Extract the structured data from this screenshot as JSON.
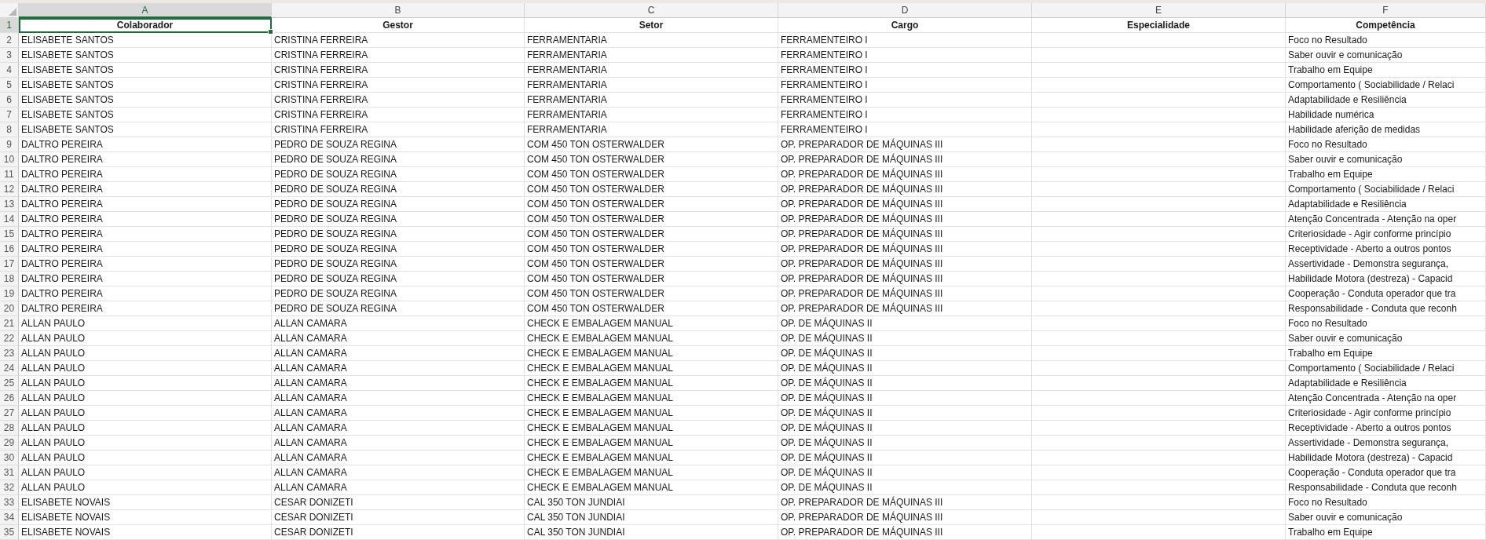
{
  "columns": [
    {
      "letter": "A",
      "title": "Colaborador",
      "selected": true
    },
    {
      "letter": "B",
      "title": "Gestor",
      "selected": false
    },
    {
      "letter": "C",
      "title": "Setor",
      "selected": false
    },
    {
      "letter": "D",
      "title": "Cargo",
      "selected": false
    },
    {
      "letter": "E",
      "title": "Especialidade",
      "selected": false
    },
    {
      "letter": "F",
      "title": "Competência",
      "selected": false
    }
  ],
  "header_row": {
    "number": "1",
    "selected": true
  },
  "rows": [
    {
      "number": "2",
      "colaborador": "ELISABETE SANTOS",
      "gestor": "CRISTINA FERREIRA",
      "setor": "FERRAMENTARIA",
      "cargo": "FERRAMENTEIRO I",
      "competencia": "Foco no Resultado",
      "selected": false
    },
    {
      "number": "3",
      "colaborador": "ELISABETE SANTOS",
      "gestor": "CRISTINA FERREIRA",
      "setor": "FERRAMENTARIA",
      "cargo": "FERRAMENTEIRO I",
      "competencia": "Saber ouvir e comunicação",
      "selected": false
    },
    {
      "number": "4",
      "colaborador": "ELISABETE SANTOS",
      "gestor": "CRISTINA FERREIRA",
      "setor": "FERRAMENTARIA",
      "cargo": "FERRAMENTEIRO I",
      "competencia": "Trabalho em Equipe",
      "selected": false
    },
    {
      "number": "5",
      "colaborador": "ELISABETE SANTOS",
      "gestor": "CRISTINA FERREIRA",
      "setor": "FERRAMENTARIA",
      "cargo": "FERRAMENTEIRO I",
      "competencia": "Comportamento ( Sociabilidade / Relaci",
      "selected": false
    },
    {
      "number": "6",
      "colaborador": "ELISABETE SANTOS",
      "gestor": "CRISTINA FERREIRA",
      "setor": "FERRAMENTARIA",
      "cargo": "FERRAMENTEIRO I",
      "competencia": "Adaptabilidade e Resiliência",
      "selected": false
    },
    {
      "number": "7",
      "colaborador": "ELISABETE SANTOS",
      "gestor": "CRISTINA FERREIRA",
      "setor": "FERRAMENTARIA",
      "cargo": "FERRAMENTEIRO I",
      "competencia": "Habilidade numérica",
      "selected": false
    },
    {
      "number": "8",
      "colaborador": "ELISABETE SANTOS",
      "gestor": "CRISTINA FERREIRA",
      "setor": "FERRAMENTARIA",
      "cargo": "FERRAMENTEIRO I",
      "competencia": "Habilidade aferição de medidas",
      "selected": false
    },
    {
      "number": "9",
      "colaborador": "DALTRO PEREIRA",
      "gestor": "PEDRO DE SOUZA REGINA",
      "setor": "COM 450 TON OSTERWALDER",
      "cargo": "OP. PREPARADOR DE MÁQUINAS III",
      "competencia": "Foco no Resultado",
      "selected": false
    },
    {
      "number": "10",
      "colaborador": "DALTRO PEREIRA",
      "gestor": "PEDRO DE SOUZA REGINA",
      "setor": "COM 450 TON OSTERWALDER",
      "cargo": "OP. PREPARADOR DE MÁQUINAS III",
      "competencia": "Saber ouvir e comunicação",
      "selected": false
    },
    {
      "number": "11",
      "colaborador": "DALTRO PEREIRA",
      "gestor": "PEDRO DE SOUZA REGINA",
      "setor": "COM 450 TON OSTERWALDER",
      "cargo": "OP. PREPARADOR DE MÁQUINAS III",
      "competencia": "Trabalho em Equipe",
      "selected": false
    },
    {
      "number": "12",
      "colaborador": "DALTRO PEREIRA",
      "gestor": "PEDRO DE SOUZA REGINA",
      "setor": "COM 450 TON OSTERWALDER",
      "cargo": "OP. PREPARADOR DE MÁQUINAS III",
      "competencia": "Comportamento ( Sociabilidade / Relaci",
      "selected": false
    },
    {
      "number": "13",
      "colaborador": "DALTRO PEREIRA",
      "gestor": "PEDRO DE SOUZA REGINA",
      "setor": "COM 450 TON OSTERWALDER",
      "cargo": "OP. PREPARADOR DE MÁQUINAS III",
      "competencia": "Adaptabilidade e Resiliência",
      "selected": false
    },
    {
      "number": "14",
      "colaborador": "DALTRO PEREIRA",
      "gestor": "PEDRO DE SOUZA REGINA",
      "setor": "COM 450 TON OSTERWALDER",
      "cargo": "OP. PREPARADOR DE MÁQUINAS III",
      "competencia": "Atenção Concentrada - Atenção na oper",
      "selected": false
    },
    {
      "number": "15",
      "colaborador": "DALTRO PEREIRA",
      "gestor": "PEDRO DE SOUZA REGINA",
      "setor": "COM 450 TON OSTERWALDER",
      "cargo": "OP. PREPARADOR DE MÁQUINAS III",
      "competencia": "Criteriosidade - Agir conforme princípio",
      "selected": false
    },
    {
      "number": "16",
      "colaborador": "DALTRO PEREIRA",
      "gestor": "PEDRO DE SOUZA REGINA",
      "setor": "COM 450 TON OSTERWALDER",
      "cargo": "OP. PREPARADOR DE MÁQUINAS III",
      "competencia": "Receptividade - Aberto a outros pontos",
      "selected": false
    },
    {
      "number": "17",
      "colaborador": "DALTRO PEREIRA",
      "gestor": "PEDRO DE SOUZA REGINA",
      "setor": "COM 450 TON OSTERWALDER",
      "cargo": "OP. PREPARADOR DE MÁQUINAS III",
      "competencia": "Assertividade - Demonstra segurança,",
      "selected": false
    },
    {
      "number": "18",
      "colaborador": "DALTRO PEREIRA",
      "gestor": "PEDRO DE SOUZA REGINA",
      "setor": "COM 450 TON OSTERWALDER",
      "cargo": "OP. PREPARADOR DE MÁQUINAS III",
      "competencia": "Habilidade Motora (destreza) - Capacid",
      "selected": false
    },
    {
      "number": "19",
      "colaborador": "DALTRO PEREIRA",
      "gestor": "PEDRO DE SOUZA REGINA",
      "setor": "COM 450 TON OSTERWALDER",
      "cargo": "OP. PREPARADOR DE MÁQUINAS III",
      "competencia": "Cooperação - Conduta operador que tra",
      "selected": false
    },
    {
      "number": "20",
      "colaborador": "DALTRO PEREIRA",
      "gestor": "PEDRO DE SOUZA REGINA",
      "setor": "COM 450 TON OSTERWALDER",
      "cargo": "OP. PREPARADOR DE MÁQUINAS III",
      "competencia": "Responsabilidade - Conduta que reconh",
      "selected": false
    },
    {
      "number": "21",
      "colaborador": "ALLAN PAULO",
      "gestor": "ALLAN CAMARA",
      "setor": "CHECK E EMBALAGEM MANUAL",
      "cargo": "OP. DE MÁQUINAS II",
      "competencia": "Foco no Resultado",
      "selected": false
    },
    {
      "number": "22",
      "colaborador": "ALLAN PAULO",
      "gestor": "ALLAN CAMARA",
      "setor": "CHECK E EMBALAGEM MANUAL",
      "cargo": "OP. DE MÁQUINAS II",
      "competencia": "Saber ouvir e comunicação",
      "selected": false
    },
    {
      "number": "23",
      "colaborador": "ALLAN PAULO",
      "gestor": "ALLAN CAMARA",
      "setor": "CHECK E EMBALAGEM MANUAL",
      "cargo": "OP. DE MÁQUINAS II",
      "competencia": "Trabalho em Equipe",
      "selected": false
    },
    {
      "number": "24",
      "colaborador": "ALLAN PAULO",
      "gestor": "ALLAN CAMARA",
      "setor": "CHECK E EMBALAGEM MANUAL",
      "cargo": "OP. DE MÁQUINAS II",
      "competencia": "Comportamento ( Sociabilidade / Relaci",
      "selected": false
    },
    {
      "number": "25",
      "colaborador": "ALLAN PAULO",
      "gestor": "ALLAN CAMARA",
      "setor": "CHECK E EMBALAGEM MANUAL",
      "cargo": "OP. DE MÁQUINAS II",
      "competencia": "Adaptabilidade e Resiliência",
      "selected": false
    },
    {
      "number": "26",
      "colaborador": "ALLAN PAULO",
      "gestor": "ALLAN CAMARA",
      "setor": "CHECK E EMBALAGEM MANUAL",
      "cargo": "OP. DE MÁQUINAS II",
      "competencia": "Atenção Concentrada - Atenção na oper",
      "selected": false
    },
    {
      "number": "27",
      "colaborador": "ALLAN PAULO",
      "gestor": "ALLAN CAMARA",
      "setor": "CHECK E EMBALAGEM MANUAL",
      "cargo": "OP. DE MÁQUINAS II",
      "competencia": "Criteriosidade - Agir conforme princípio",
      "selected": false
    },
    {
      "number": "28",
      "colaborador": "ALLAN PAULO",
      "gestor": "ALLAN CAMARA",
      "setor": "CHECK E EMBALAGEM MANUAL",
      "cargo": "OP. DE MÁQUINAS II",
      "competencia": "Receptividade - Aberto a outros pontos",
      "selected": false
    },
    {
      "number": "29",
      "colaborador": "ALLAN PAULO",
      "gestor": "ALLAN CAMARA",
      "setor": "CHECK E EMBALAGEM MANUAL",
      "cargo": "OP. DE MÁQUINAS II",
      "competencia": "Assertividade - Demonstra segurança,",
      "selected": false
    },
    {
      "number": "30",
      "colaborador": "ALLAN PAULO",
      "gestor": "ALLAN CAMARA",
      "setor": "CHECK E EMBALAGEM MANUAL",
      "cargo": "OP. DE MÁQUINAS II",
      "competencia": "Habilidade Motora (destreza) - Capacid",
      "selected": false
    },
    {
      "number": "31",
      "colaborador": "ALLAN PAULO",
      "gestor": "ALLAN CAMARA",
      "setor": "CHECK E EMBALAGEM MANUAL",
      "cargo": "OP. DE MÁQUINAS II",
      "competencia": "Cooperação - Conduta operador que tra",
      "selected": false
    },
    {
      "number": "32",
      "colaborador": "ALLAN PAULO",
      "gestor": "ALLAN CAMARA",
      "setor": "CHECK E EMBALAGEM MANUAL",
      "cargo": "OP. DE MÁQUINAS II",
      "competencia": "Responsabilidade - Conduta que reconh",
      "selected": false
    },
    {
      "number": "33",
      "colaborador": "ELISABETE NOVAIS",
      "gestor": "CESAR DONIZETI",
      "setor": "CAL 350 TON JUNDIAI",
      "cargo": "OP. PREPARADOR DE MÁQUINAS III",
      "competencia": "Foco no Resultado",
      "selected": false
    },
    {
      "number": "34",
      "colaborador": "ELISABETE NOVAIS",
      "gestor": "CESAR DONIZETI",
      "setor": "CAL 350 TON JUNDIAI",
      "cargo": "OP. PREPARADOR DE MÁQUINAS III",
      "competencia": "Saber ouvir e comunicação",
      "selected": false
    },
    {
      "number": "35",
      "colaborador": "ELISABETE NOVAIS",
      "gestor": "CESAR DONIZETI",
      "setor": "CAL 350 TON JUNDIAI",
      "cargo": "OP. PREPARADOR DE MÁQUINAS III",
      "competencia": "Trabalho em Equipe",
      "selected": false
    }
  ]
}
